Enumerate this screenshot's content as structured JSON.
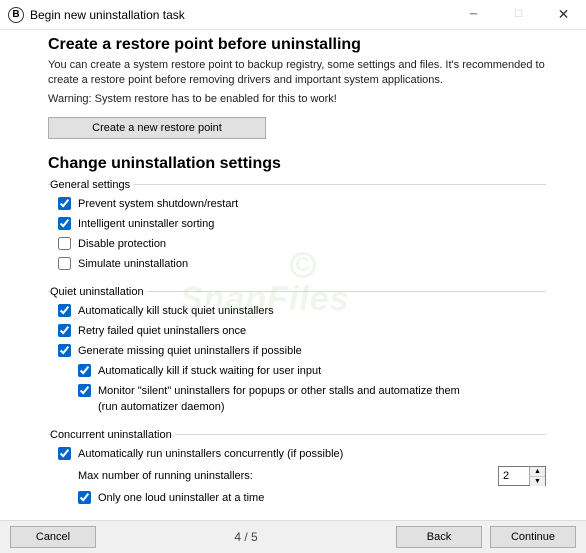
{
  "window": {
    "title": "Begin new uninstallation task",
    "app_icon_letter": "B"
  },
  "section_restore": {
    "heading": "Create a restore point before uninstalling",
    "desc": "You can create a system restore point to backup registry, some settings and files. It's recommended to create a restore point before removing drivers and important system applications.",
    "warning": "Warning: System restore has to be enabled for this to work!",
    "button": "Create a new restore point"
  },
  "section_settings": {
    "heading": "Change uninstallation settings"
  },
  "general": {
    "legend": "General settings",
    "prevent_shutdown": "Prevent system shutdown/restart",
    "intelligent_sort": "Intelligent uninstaller sorting",
    "disable_protection": "Disable protection",
    "simulate": "Simulate uninstallation"
  },
  "quiet": {
    "legend": "Quiet uninstallation",
    "auto_kill": "Automatically kill stuck quiet uninstallers",
    "retry": "Retry failed quiet uninstallers once",
    "generate": "Generate missing quiet uninstallers if possible",
    "auto_kill_wait": "Automatically kill if stuck waiting for user input",
    "monitor": "Monitor \"silent\" uninstallers for popups or other stalls and automatize them (run automatizer daemon)"
  },
  "concurrent": {
    "legend": "Concurrent uninstallation",
    "auto_run": "Automatically run uninstallers concurrently (if possible)",
    "max_label": "Max number of running uninstallers:",
    "max_value": "2",
    "one_loud": "Only one loud uninstaller at a time"
  },
  "footer": {
    "cancel": "Cancel",
    "progress": "4 / 5",
    "back": "Back",
    "continue": "Continue"
  },
  "watermark": "SnapFiles"
}
